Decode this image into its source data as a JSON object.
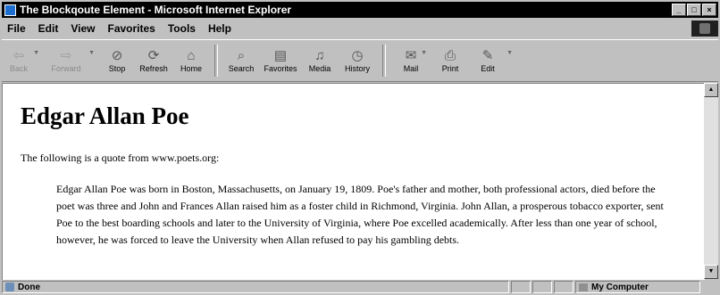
{
  "window": {
    "title": "The Blockqoute Element - Microsoft Internet Explorer"
  },
  "menu": [
    "File",
    "Edit",
    "View",
    "Favorites",
    "Tools",
    "Help"
  ],
  "toolbar": [
    {
      "label": "Back",
      "icon": "back-arrow-icon",
      "glyph": "⇦"
    },
    {
      "label": "Forward",
      "icon": "forward-arrow-icon",
      "glyph": "⇨"
    },
    {
      "label": "Stop",
      "icon": "stop-icon",
      "glyph": "⊘"
    },
    {
      "label": "Refresh",
      "icon": "refresh-icon",
      "glyph": "⟳"
    },
    {
      "label": "Home",
      "icon": "home-icon",
      "glyph": "⌂"
    },
    {
      "label": "Search",
      "icon": "search-icon",
      "glyph": "⌕"
    },
    {
      "label": "Favorites",
      "icon": "favorites-icon",
      "glyph": "▤"
    },
    {
      "label": "Media",
      "icon": "media-icon",
      "glyph": "♫"
    },
    {
      "label": "History",
      "icon": "history-icon",
      "glyph": "◷"
    },
    {
      "label": "Mail",
      "icon": "mail-icon",
      "glyph": "✉"
    },
    {
      "label": "Print",
      "icon": "print-icon",
      "glyph": "⎙"
    },
    {
      "label": "Edit",
      "icon": "edit-icon",
      "glyph": "✎"
    }
  ],
  "page": {
    "heading": "Edgar Allan Poe",
    "intro": "The following is a quote from www.poets.org:",
    "quote": "Edgar Allan Poe was born in Boston, Massachusetts, on January 19, 1809. Poe's father and mother, both professional actors, died before the poet was three and John and Frances Allan raised him as a foster child in Richmond, Virginia. John Allan, a prosperous tobacco exporter, sent Poe to the best boarding schools and later to the University of Virginia, where Poe excelled academically. After less than one year of school, however, he was forced to leave the University when Allan refused to pay his gambling debts."
  },
  "status": {
    "text": "Done",
    "zone": "My Computer"
  }
}
